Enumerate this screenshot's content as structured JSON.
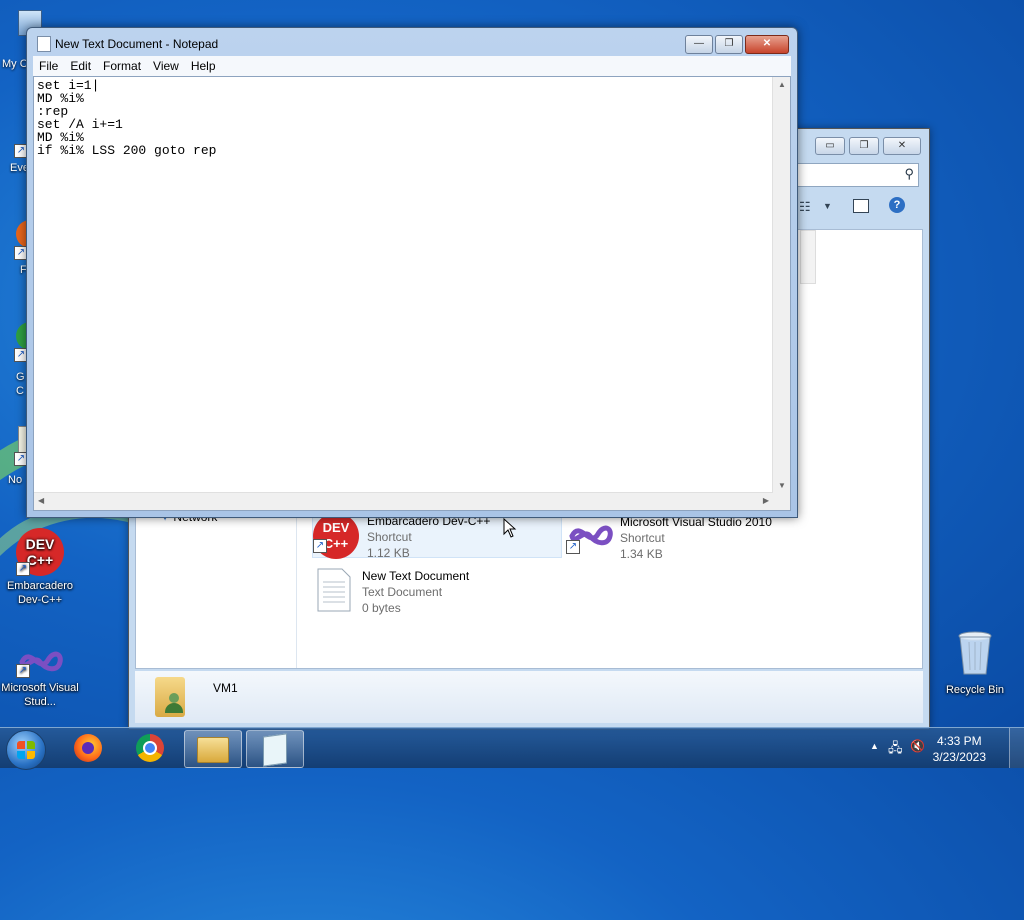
{
  "desktop": {
    "icons": [
      {
        "label": "My C"
      },
      {
        "label": "Eve"
      },
      {
        "label": "F"
      },
      {
        "label": "G C"
      },
      {
        "label": "No"
      },
      {
        "label": "Embarcadero Dev-C++",
        "logo_text": "DEV C++"
      },
      {
        "label": "Microsoft Visual Stud..."
      },
      {
        "label": "Recycle Bin"
      }
    ]
  },
  "explorer": {
    "search_icon": "search-icon",
    "nav_item": "Network",
    "files": [
      {
        "name": "Embarcadero Dev-C++",
        "type": "Shortcut",
        "size": "1.12 KB",
        "logo_text": "DEV C++"
      },
      {
        "name": "Microsoft Visual Studio 2010",
        "type": "Shortcut",
        "size": "1.34 KB"
      },
      {
        "name": "New Text Document",
        "type": "Text Document",
        "size": "0 bytes"
      }
    ],
    "details_name": "VM1",
    "controls": {
      "minimize": "▭",
      "maximize": "❐",
      "close": "✕"
    }
  },
  "notepad": {
    "title": "New Text Document - Notepad",
    "menu": [
      "File",
      "Edit",
      "Format",
      "View",
      "Help"
    ],
    "content": "set i=1|\nMD %i%\n:rep\nset /A i+=1\nMD %i%\nif %i% LSS 200 goto rep",
    "controls": {
      "minimize": "—",
      "maximize": "❐",
      "close": "✕"
    }
  },
  "taskbar": {
    "time": "4:33 PM",
    "date": "3/23/2023",
    "pinned": [
      "firefox-icon",
      "chrome-icon",
      "explorer-icon",
      "notepad-icon"
    ]
  },
  "colors": {
    "desktop_bg": "#1363c4",
    "devcpp_red": "#d62828",
    "taskbar": "#1f4f86"
  }
}
